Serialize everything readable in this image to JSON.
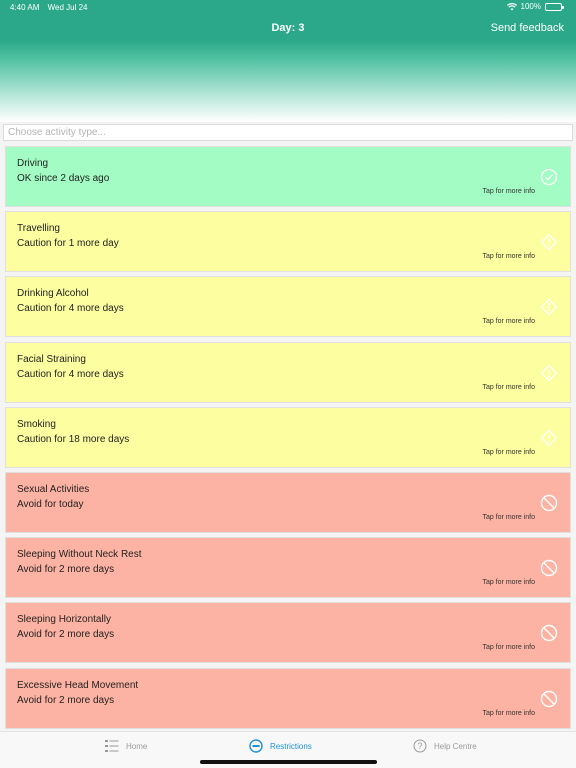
{
  "status_bar": {
    "time": "4:40 AM",
    "date": "Wed Jul 24",
    "battery": "100%"
  },
  "nav": {
    "title": "Day: 3",
    "feedback": "Send feedback"
  },
  "search": {
    "placeholder": "Choose activity type..."
  },
  "more_info_label": "Tap for more info",
  "activities": [
    {
      "title": "Driving",
      "status": "OK since 2 days ago",
      "level": "ok",
      "icon": "check-circle-icon"
    },
    {
      "title": "Travelling",
      "status": "Caution for 1 more day",
      "level": "caution",
      "icon": "caution-diamond-icon"
    },
    {
      "title": "Drinking Alcohol",
      "status": "Caution for 4 more days",
      "level": "caution",
      "icon": "caution-diamond-icon"
    },
    {
      "title": "Facial Straining",
      "status": "Caution for 4 more days",
      "level": "caution",
      "icon": "caution-diamond-icon"
    },
    {
      "title": "Smoking",
      "status": "Caution for 18 more days",
      "level": "caution",
      "icon": "caution-diamond-icon"
    },
    {
      "title": "Sexual Activities",
      "status": "Avoid for today",
      "level": "avoid",
      "icon": "prohibited-icon"
    },
    {
      "title": "Sleeping Without Neck Rest",
      "status": "Avoid for 2 more days",
      "level": "avoid",
      "icon": "prohibited-icon"
    },
    {
      "title": "Sleeping Horizontally",
      "status": "Avoid for 2 more days",
      "level": "avoid",
      "icon": "prohibited-icon"
    },
    {
      "title": "Excessive Head Movement",
      "status": "Avoid for 2 more days",
      "level": "avoid",
      "icon": "prohibited-icon"
    }
  ],
  "colors": {
    "header": "#2aa889",
    "ok": "#a2fcc3",
    "caution": "#fdfea0",
    "avoid": "#fdb3a3",
    "active_tab": "#1e90d6"
  },
  "tabs": [
    {
      "label": "Home",
      "icon": "list-icon",
      "active": false
    },
    {
      "label": "Restrictions",
      "icon": "minus-circle-icon",
      "active": true
    },
    {
      "label": "Help Centre",
      "icon": "question-circle-icon",
      "active": false
    }
  ]
}
